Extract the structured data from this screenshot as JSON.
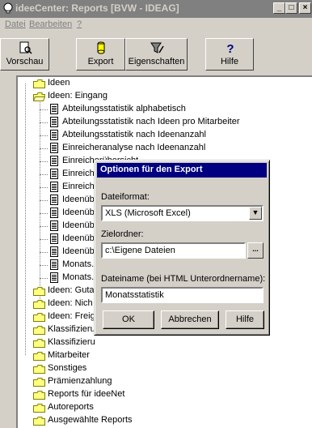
{
  "window": {
    "title": "ideeCenter: Reports [BVW - IDEAG]"
  },
  "menu": [
    "Datei",
    "Bearbeiten",
    "?"
  ],
  "toolbar": [
    {
      "label": "Vorschau",
      "icon": "preview-icon"
    },
    {
      "label": "Export",
      "icon": "export-icon"
    },
    {
      "label": "Eigenschaften",
      "icon": "properties-icon"
    },
    {
      "label": "Hilfe",
      "icon": "help-icon"
    }
  ],
  "tree": {
    "ideen": "Ideen",
    "eingang": "Ideen: Eingang",
    "reports": [
      "Abteilungsstatistik alphabetisch",
      "Abteilungsstatistik nach Ideen pro Mitarbeiter",
      "Abteilungsstatistik nach Ideenanzahl",
      "Einreicheranalyse nach Ideenanzahl",
      "Einreicherübersicht",
      "Einreich",
      "Einreich",
      "Ideenüb",
      "Ideenüb",
      "Ideenüb",
      "Ideenüb",
      "Ideenüb",
      "Monats.",
      "Monats."
    ],
    "folders": [
      "Ideen: Guta",
      "Ideen: Nich",
      "Ideen: Freig",
      "Klassifizieru",
      "Klassifizieru",
      "Mitarbeiter",
      "Sonstiges",
      "Prämienzahlung",
      "Reports für ideeNet",
      "Autoreports",
      "Ausgewählte Reports"
    ]
  },
  "dialog": {
    "title": "Optionen für den Export",
    "format_label": "Dateiformat:",
    "format_value": "XLS (Microsoft Excel)",
    "folder_label": "Zielordner:",
    "folder_value": "c:\\Eigene Dateien",
    "browse_label": "...",
    "filename_label": "Dateiname (bei HTML Unterordnername):",
    "filename_value": "Monatsstatistik",
    "ok": "OK",
    "cancel": "Abbrechen",
    "help": "Hilfe"
  },
  "colors": {
    "titlebar_inactive": "#808080",
    "dialog_title": "#000080",
    "face": "#d4d0c8"
  }
}
